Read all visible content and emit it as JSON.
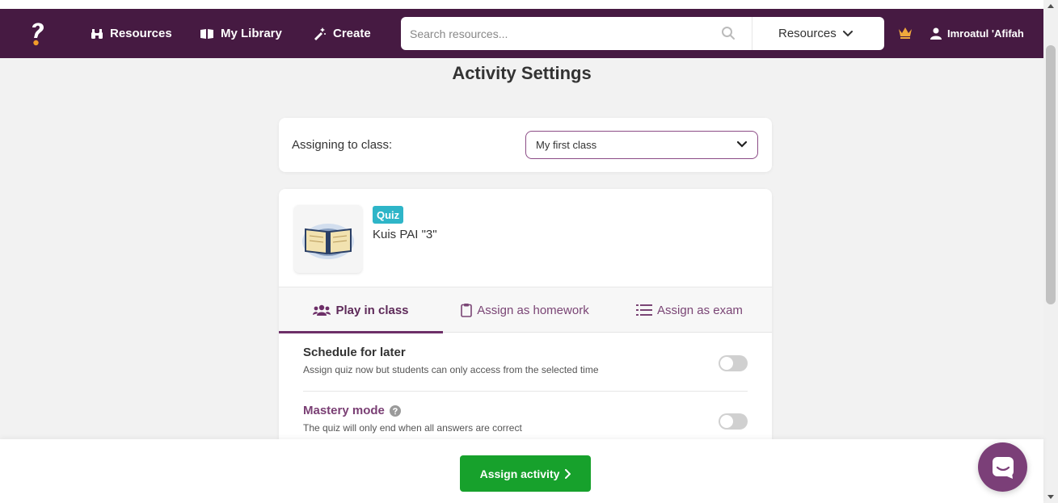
{
  "navbar": {
    "items": [
      {
        "label": "Resources",
        "icon": "binoculars-icon"
      },
      {
        "label": "My Library",
        "icon": "book-icon"
      },
      {
        "label": "Create",
        "icon": "magic-wand-icon"
      }
    ],
    "search": {
      "placeholder": "Search resources...",
      "scope": "Resources"
    },
    "user_name": "Imroatul 'Afifah"
  },
  "page": {
    "title": "Activity Settings"
  },
  "class_selector": {
    "label": "Assigning to class:",
    "selected": "My first class"
  },
  "activity": {
    "badge": "Quiz",
    "title": "Kuis PAI \"3\""
  },
  "tabs": [
    {
      "label": "Play in class",
      "icon": "users-icon",
      "active": true
    },
    {
      "label": "Assign as homework",
      "icon": "clipboard-icon",
      "active": false
    },
    {
      "label": "Assign as exam",
      "icon": "list-icon",
      "active": false
    }
  ],
  "settings": [
    {
      "title": "Schedule for later",
      "description": "Assign quiz now but students can only access from the selected time",
      "enabled": false
    },
    {
      "title": "Mastery mode",
      "description": "The quiz will only end when all answers are correct",
      "enabled": false
    }
  ],
  "footer": {
    "assign_label": "Assign activity"
  },
  "colors": {
    "navbar": "#461a42",
    "accent": "#6d2f68",
    "badge": "#2eb5c8",
    "assign_button": "#17a12c",
    "chat_bubble": "#7b3f78"
  }
}
